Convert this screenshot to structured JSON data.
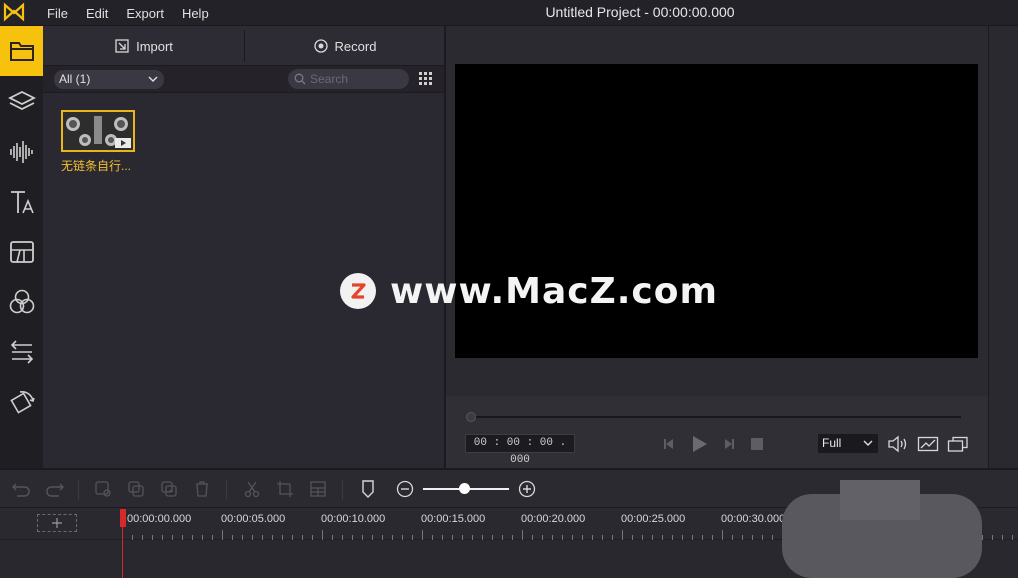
{
  "menu": {
    "items": [
      "File",
      "Edit",
      "Export",
      "Help"
    ],
    "window_title": "Untitled Project - 00:00:00.000"
  },
  "left_toolbar": {
    "items": [
      {
        "icon": "folder-icon",
        "active": true
      },
      {
        "icon": "layers-icon",
        "active": false
      },
      {
        "icon": "audio-wave-icon",
        "active": false
      },
      {
        "icon": "text-icon",
        "active": false
      },
      {
        "icon": "transitions-icon",
        "active": false
      },
      {
        "icon": "filters-icon",
        "active": false
      },
      {
        "icon": "motion-icon",
        "active": false
      },
      {
        "icon": "rotate-icon",
        "active": false
      }
    ]
  },
  "media_panel": {
    "import_label": "Import",
    "record_label": "Record",
    "filter_selected": "All (1)",
    "search_placeholder": "Search",
    "files": [
      {
        "name": "无链条自行..."
      }
    ]
  },
  "preview": {
    "timecode": "00 : 00 : 00 . 000",
    "zoom_selected": "Full"
  },
  "timeline": {
    "ruler_labels": [
      "00:00:00.000",
      "00:00:05.000",
      "00:00:10.000",
      "00:00:15.000",
      "00:00:20.000",
      "00:00:25.000",
      "00:00:30.000"
    ]
  },
  "watermark": {
    "text": "www.MacZ.com"
  },
  "colors": {
    "accent": "#f6c20e",
    "playhead": "#d62a2a",
    "panel": "#2a2830"
  }
}
